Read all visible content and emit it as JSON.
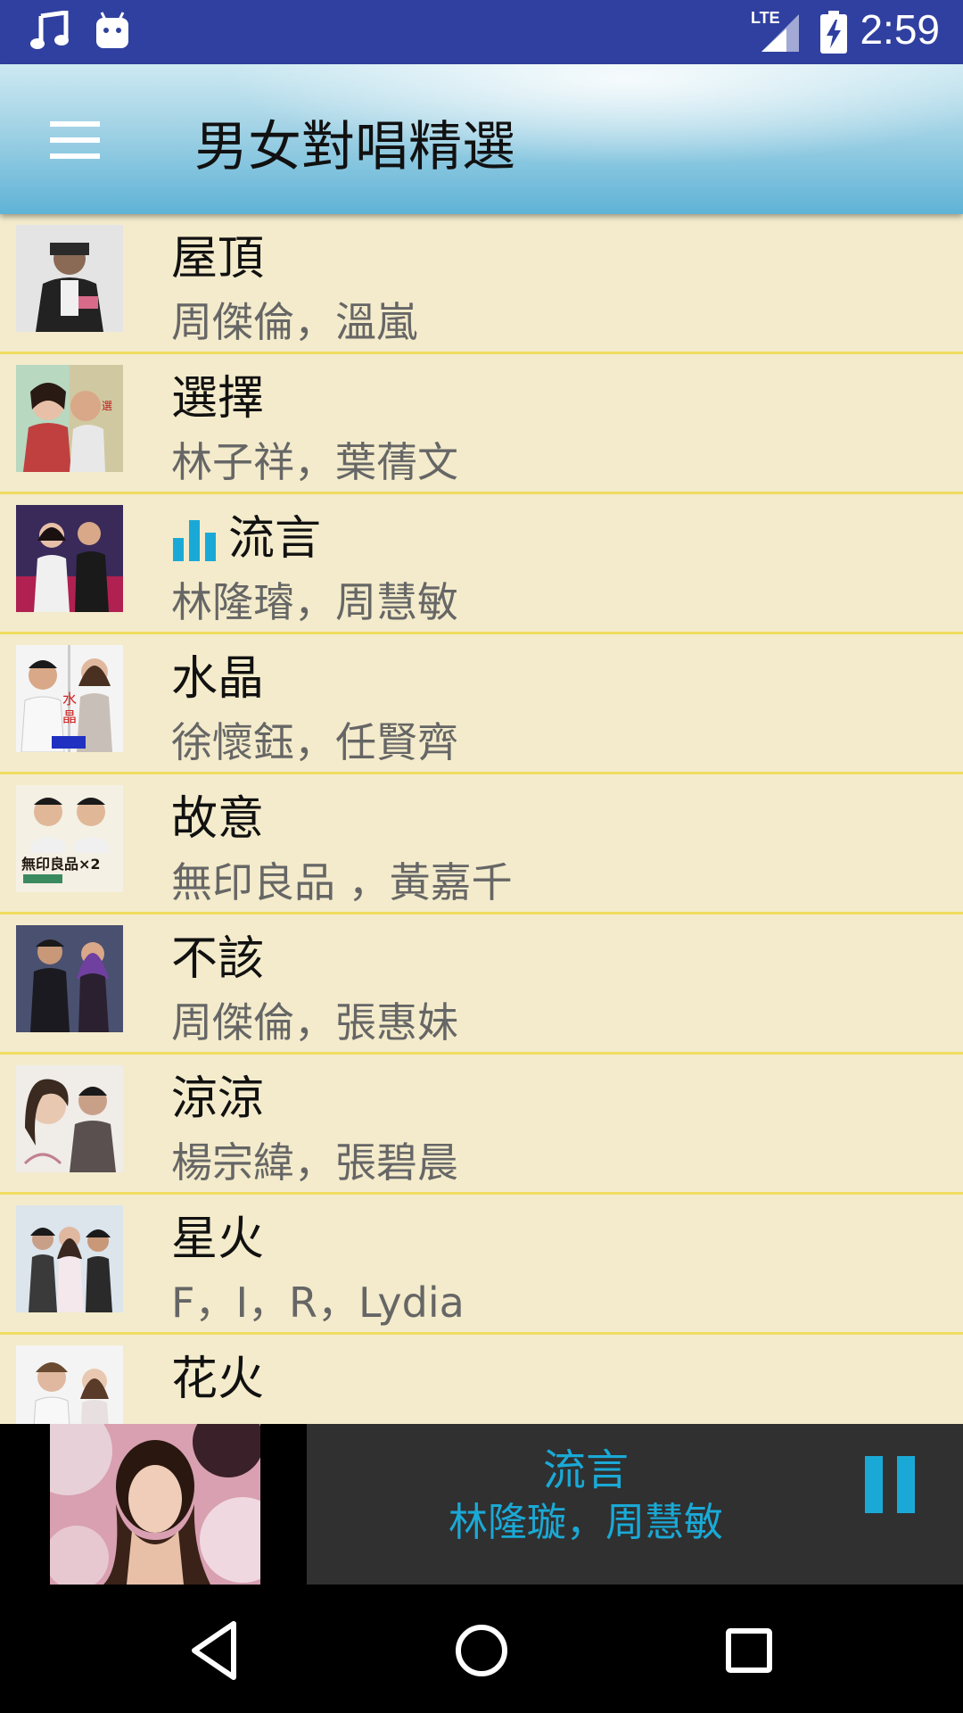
{
  "status_bar": {
    "time": "2:59",
    "network": "LTE",
    "icons": [
      "music-note-icon",
      "android-icon",
      "signal-icon",
      "battery-charging-icon"
    ]
  },
  "app_bar": {
    "title": "男女對唱精選",
    "menu_icon": "hamburger-menu-icon"
  },
  "songs": [
    {
      "title": "屋頂",
      "artist": "周傑倫，溫嵐",
      "playing": false
    },
    {
      "title": "選擇",
      "artist": "林子祥，葉蒨文",
      "playing": false
    },
    {
      "title": "流言",
      "artist": "林隆璿，周慧敏",
      "playing": true
    },
    {
      "title": "水晶",
      "artist": "徐懷鈺，任賢齊",
      "playing": false
    },
    {
      "title": "故意",
      "artist": "無印良品 ，黃嘉千",
      "playing": false
    },
    {
      "title": "不該",
      "artist": "周傑倫，張惠妹",
      "playing": false
    },
    {
      "title": "涼涼",
      "artist": "楊宗緯，張碧晨",
      "playing": false
    },
    {
      "title": "星火",
      "artist": "F，I，R，Lydia",
      "playing": false
    },
    {
      "title": "花火",
      "artist": "",
      "playing": false
    }
  ],
  "now_playing": {
    "title": "流言",
    "artist": "林隆璇，周慧敏",
    "control_icon": "pause-icon"
  },
  "colors": {
    "status_bar": "#3040a0",
    "list_background": "#f3ebcb",
    "divider": "#f0dc60",
    "accent": "#1aa9d6",
    "player_background": "#303030"
  },
  "nav_bar": {
    "icons": [
      "back-icon",
      "home-icon",
      "recents-icon"
    ]
  }
}
